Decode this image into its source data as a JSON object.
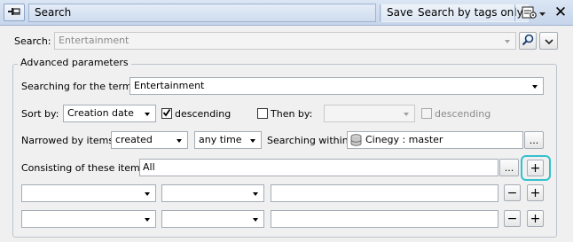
{
  "titlebar": {
    "title": "Search",
    "save_label": "Save",
    "search_by_tags_label": "Search by tags only",
    "close_glyph": "✕"
  },
  "search": {
    "label": "Search:",
    "value": "Entertainment"
  },
  "advanced": {
    "group_title": "Advanced parameters",
    "terms_label": "Searching for the terms:",
    "terms_value": "Entertainment",
    "sort_label": "Sort by:",
    "sort_value": "Creation date",
    "descending_label": "descending",
    "descending_checked": true,
    "then_by_label": "Then by:",
    "then_by_checked": false,
    "then_by_value": "",
    "then_descending_label": "descending",
    "then_descending_checked": false,
    "narrowed_label": "Narrowed by items:",
    "narrowed_value": "created",
    "time_value": "any time",
    "within_label": "Searching within:",
    "within_value": "Cinegy : master",
    "browse_label": "...",
    "consisting_label": "Consisting of these items:",
    "consisting_value": "All",
    "plus_label": "+",
    "minus_label": "−"
  },
  "colors": {
    "highlight": "#35c1cc"
  }
}
